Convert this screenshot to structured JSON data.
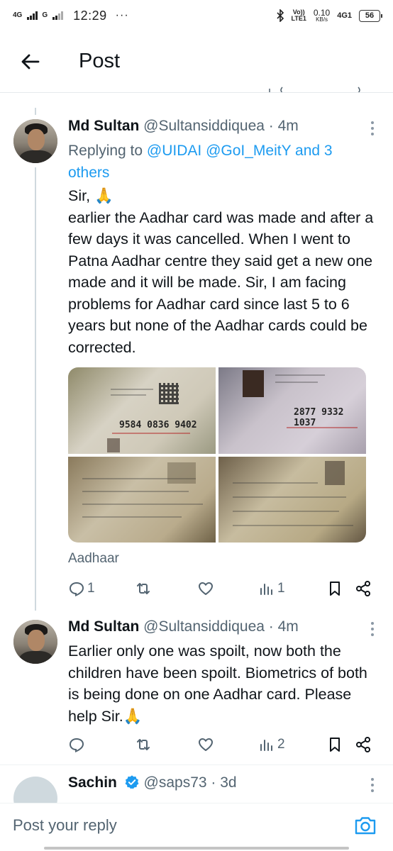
{
  "status_bar": {
    "network_left_1": "4G",
    "network_left_2": "G",
    "time": "12:29",
    "dots": "···",
    "speed_value": "0.10",
    "speed_unit": "KB/s",
    "volte_top": "Vo))",
    "volte_bottom": "LTE1",
    "network_right": "4G1",
    "battery": "56"
  },
  "header": {
    "title": "Post"
  },
  "thread": [
    {
      "name": "Md Sultan",
      "handle": "@Sultansiddiquea · 4m",
      "replying_prefix": "Replying to ",
      "replying_mentions": "@UIDAI @GoI_MeitY and 3 others",
      "text_lines": [
        "Sir, 🙏",
        "earlier the Aadhar card was made and after a few days it was cancelled. When I went to Patna Aadhar centre they said get a new one made and it will be made. Sir, I am facing problems for Aadhar card since last 5 to 6 years but none of the Aadhar cards could be corrected."
      ],
      "media_texts": {
        "card1_number": "9584 0836 9402",
        "card2_number": "2877 9332 1037"
      },
      "media_label": "Aadhaar",
      "actions": {
        "replies": "1",
        "reposts": "",
        "likes": "",
        "views": "1"
      }
    },
    {
      "name": "Md Sultan",
      "handle": "@Sultansiddiquea · 4m",
      "text": "Earlier only one was spoilt, now both the children have been spoilt. Biometrics of both is being done on one Aadhar card. Please help Sir.🙏",
      "actions": {
        "replies": "",
        "reposts": "",
        "likes": "",
        "views": "2"
      }
    },
    {
      "name": "Sachin",
      "handle": "@saps73 · 3d"
    }
  ],
  "reply_bar": {
    "placeholder": "Post your reply"
  },
  "colors": {
    "link": "#1d9bf0",
    "secondary_text": "#536471",
    "primary_text": "#0f1419",
    "verified": "#1d9bf0"
  }
}
